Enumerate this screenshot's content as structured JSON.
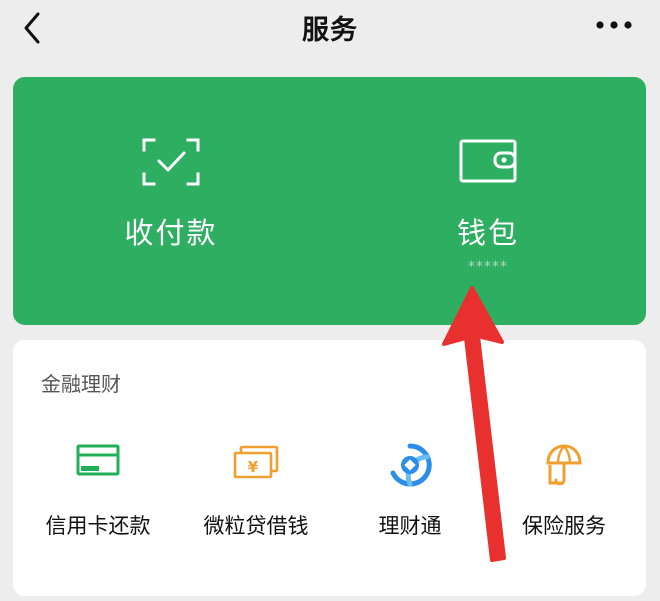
{
  "header": {
    "title": "服务",
    "back_icon": "chevron-left-icon",
    "more_icon": "more-dots-icon"
  },
  "top_card": {
    "background": "#2eae60",
    "items": [
      {
        "label": "收付款",
        "icon": "scan-check-icon"
      },
      {
        "label": "钱包",
        "icon": "wallet-icon",
        "sub": "*****"
      }
    ]
  },
  "finance": {
    "section_title": "金融理财",
    "items": [
      {
        "label": "信用卡还款",
        "icon": "credit-card-icon",
        "color": "#21b05a"
      },
      {
        "label": "微粒贷借钱",
        "icon": "yuan-bills-icon",
        "color": "#f0a030"
      },
      {
        "label": "理财通",
        "icon": "licaitong-icon",
        "color": "#2b8ee8"
      },
      {
        "label": "保险服务",
        "icon": "umbrella-icon",
        "color": "#f0a030"
      }
    ]
  },
  "annotation": {
    "icon": "red-arrow-icon",
    "color": "#e8312f"
  }
}
